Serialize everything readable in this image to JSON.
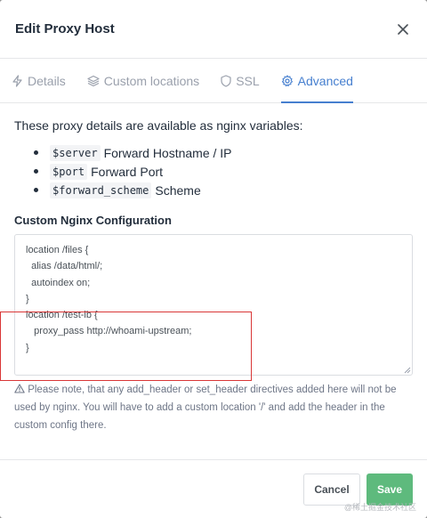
{
  "dialog": {
    "title": "Edit Proxy Host",
    "close_icon": "close-icon"
  },
  "tabs": [
    {
      "label": "Details",
      "icon": "bolt-icon",
      "active": false
    },
    {
      "label": "Custom locations",
      "icon": "layers-icon",
      "active": false
    },
    {
      "label": "SSL",
      "icon": "shield-icon",
      "active": false
    },
    {
      "label": "Advanced",
      "icon": "gear-icon",
      "active": true
    }
  ],
  "advanced": {
    "intro": "These proxy details are available as nginx variables:",
    "variables": [
      {
        "code": "$server",
        "desc": "Forward Hostname / IP"
      },
      {
        "code": "$port",
        "desc": "Forward Port"
      },
      {
        "code": "$forward_scheme",
        "desc": "Scheme"
      }
    ],
    "config_label": "Custom Nginx Configuration",
    "config_lines": [
      "location /files {",
      "  alias /data/html/;",
      "  autoindex on;",
      "}",
      "location /test-lb {",
      "   proxy_pass http://whoami-upstream;",
      "}"
    ],
    "note": "Please note, that any add_header or set_header directives added here will not be used by nginx. You will have to add a custom location '/' and add the header in the custom config there.",
    "note_icon": "warning-icon"
  },
  "footer": {
    "cancel_label": "Cancel",
    "save_label": "Save"
  },
  "watermark": "@稀土掘金技术社区",
  "colors": {
    "accent": "#467fcf",
    "save": "#5eba7d",
    "highlight": "#d93737"
  }
}
